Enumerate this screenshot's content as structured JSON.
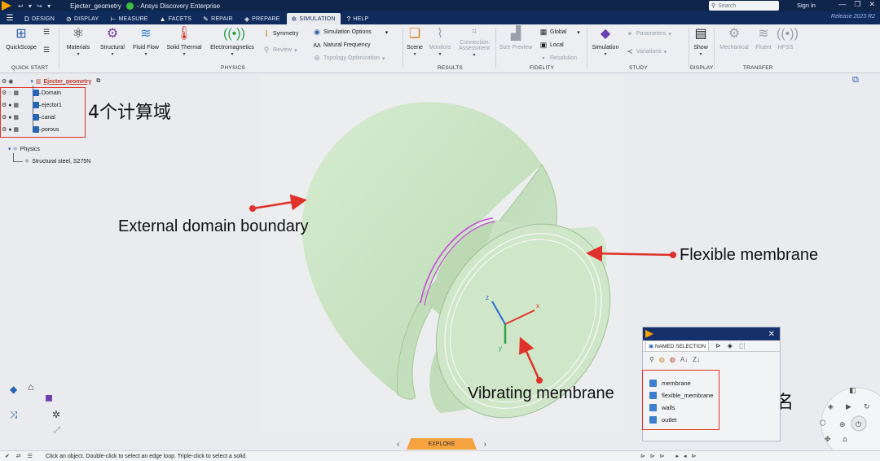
{
  "titlebar": {
    "quick_access": "↩ ▾ ↪ ▾",
    "document_title": "Ejecter_geometry",
    "app_name": "- Ansys Discovery Enterprise",
    "search_placeholder": "Search",
    "signin": "Sign in"
  },
  "tabs": [
    {
      "label": "Design",
      "icon": "D"
    },
    {
      "label": "Display",
      "icon": "⊘"
    },
    {
      "label": "Measure",
      "icon": "⊢"
    },
    {
      "label": "Facets",
      "icon": "▲"
    },
    {
      "label": "Repair",
      "icon": "✎"
    },
    {
      "label": "Prepare",
      "icon": "◈"
    },
    {
      "label": "Simulation",
      "icon": "✲"
    },
    {
      "label": "Help",
      "icon": "?"
    }
  ],
  "active_tab": "Simulation",
  "release": "Release 2023 R2",
  "ribbon": {
    "quickscope": "QuickScope",
    "materials": "Materials",
    "structural": "Structural",
    "fluid_flow": "Fluid Flow",
    "solid_thermal": "Solid Thermal",
    "electromagnetics": "Electromagnetics",
    "symmetry": "Symmetry",
    "review": "Review",
    "simulation_options": "Simulation Options",
    "natural_frequency": "Natural Frequency",
    "topology_optimization": "Topology Optimization",
    "scene": "Scene",
    "monitors": "Monitors",
    "connection_assessment_1": "Connection",
    "connection_assessment_2": "Assessment",
    "size_preview": "Size Preview",
    "global": "Global",
    "local": "Local",
    "resolution": "Resolution",
    "simulation": "Simulation",
    "parameters": "Parameters",
    "variations": "Variations",
    "show": "Show",
    "mechanical": "Mechanical",
    "fluent": "Fluent",
    "hfss": "HFSS",
    "groups": {
      "quick_start": "Quick Start",
      "physics": "Physics",
      "results": "Results",
      "fidelity": "Fidelity",
      "study": "Study",
      "display": "Display",
      "transfer": "Transfer"
    }
  },
  "tree": {
    "root": "Ejecter_geometry",
    "bodies": [
      "Domain",
      "ejector1",
      "canal",
      "porous"
    ],
    "physics": "Physics",
    "physics_child": "Structural steel, S275N"
  },
  "annotations": {
    "domain_count": "4个计算域",
    "external": "External domain boundary",
    "flexible": "Flexible membrane",
    "vibrating": "Vibrating membrane",
    "naming": "边界命名"
  },
  "named_selection": {
    "tab_label": "Named Selection",
    "items": [
      "membrane",
      "flexible_membrane",
      "walls",
      "outlet"
    ]
  },
  "explore": "Explore",
  "status_text": "Click an object. Double-click to select an edge loop. Triple-click to select a solid.",
  "colors": {
    "titlebar": "#10254a",
    "tabbar": "#0f2b5b",
    "geometry": "#c9e3c2",
    "accent": "#f5a341",
    "highlight_red": "#e0322a"
  }
}
